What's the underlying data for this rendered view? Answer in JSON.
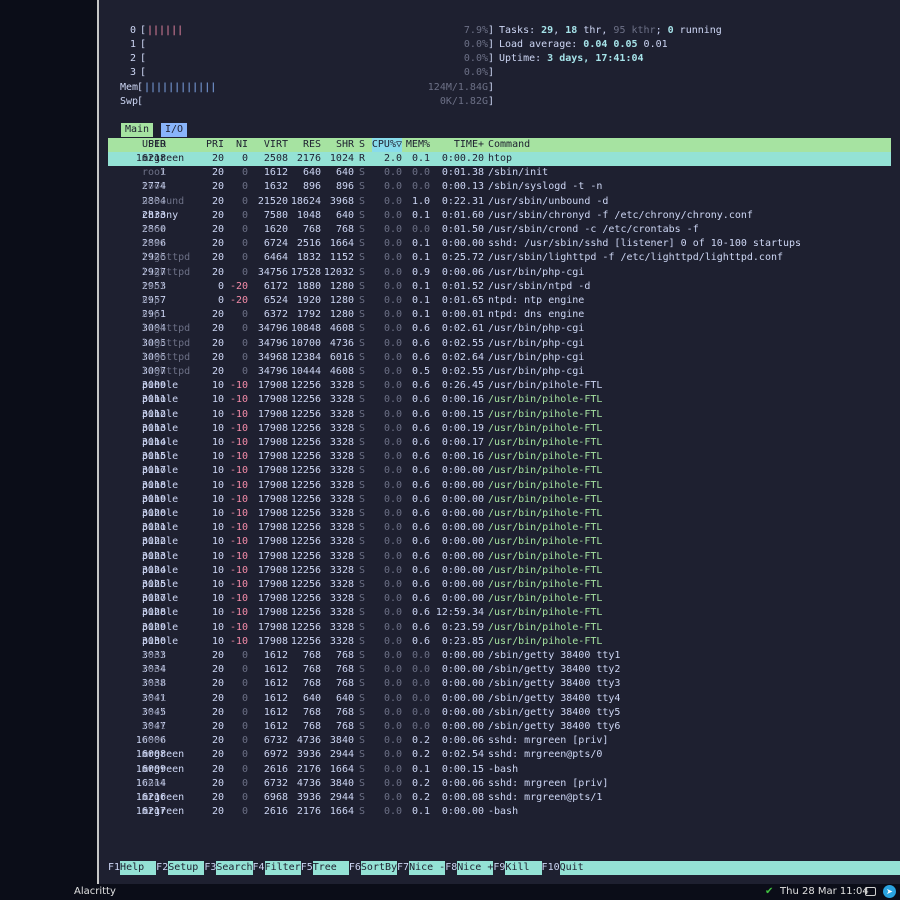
{
  "meters": [
    {
      "label": "0",
      "bars": "||||||",
      "value": "7.9%"
    },
    {
      "label": "1",
      "bars": "",
      "value": "0.0%"
    },
    {
      "label": "2",
      "bars": "",
      "value": "0.0%"
    },
    {
      "label": "3",
      "bars": "",
      "value": "0.0%"
    },
    {
      "label": "Mem",
      "bars": "||||||||||||",
      "value": "124M/1.84G"
    },
    {
      "label": "Swp",
      "bars": "",
      "value": "0K/1.82G"
    }
  ],
  "info": {
    "tasks_label": "Tasks: ",
    "tasks": "29",
    "thr_sep": ", ",
    "thr": "18",
    "thr_label": " thr, ",
    "kthr": "95 kthr",
    "kthr_sep": "; ",
    "running": "0",
    "running_label": " running",
    "load_label": "Load average: ",
    "load1": "0.04",
    "load5": "0.05",
    "load15": "0.01",
    "uptime_label": "Uptime: ",
    "uptime": "3 days, 17:41:04"
  },
  "tabs": {
    "main": "Main",
    "io": "I/O"
  },
  "header": {
    "pid": "PID",
    "user": "USER",
    "pri": "PRI",
    "ni": "NI",
    "virt": "VIRT",
    "res": "RES",
    "shr": "SHR",
    "s": "S",
    "cpu": "CPU%▽",
    "mem": "MEM%",
    "time": "TIME+",
    "cmd": "Command"
  },
  "processes": [
    [
      "16218",
      "mrgreen",
      "20",
      "0",
      "2508",
      "2176",
      "1024",
      "R",
      "2.0",
      "0.1",
      "0:00.20",
      "htop"
    ],
    [
      "1",
      "root",
      "20",
      "0",
      "1612",
      "640",
      "640",
      "S",
      "0.0",
      "0.0",
      "0:01.38",
      "/sbin/init"
    ],
    [
      "2774",
      "root",
      "20",
      "0",
      "1632",
      "896",
      "896",
      "S",
      "0.0",
      "0.0",
      "0:00.13",
      "/sbin/syslogd -t -n"
    ],
    [
      "2804",
      "unbound",
      "20",
      "0",
      "21520",
      "18624",
      "3968",
      "S",
      "0.0",
      "1.0",
      "0:22.31",
      "/usr/sbin/unbound -d"
    ],
    [
      "2833",
      "chrony",
      "20",
      "0",
      "7580",
      "1048",
      "640",
      "S",
      "0.0",
      "0.1",
      "0:01.60",
      "/usr/sbin/chronyd -f /etc/chrony/chrony.conf"
    ],
    [
      "2860",
      "root",
      "20",
      "0",
      "1620",
      "768",
      "768",
      "S",
      "0.0",
      "0.0",
      "0:01.50",
      "/usr/sbin/crond -c /etc/crontabs -f"
    ],
    [
      "2896",
      "root",
      "20",
      "0",
      "6724",
      "2516",
      "1664",
      "S",
      "0.0",
      "0.1",
      "0:00.00",
      "sshd: /usr/sbin/sshd [listener] 0 of 10-100 startups"
    ],
    [
      "2926",
      "lighttpd",
      "20",
      "0",
      "6464",
      "1832",
      "1152",
      "S",
      "0.0",
      "0.1",
      "0:25.72",
      "/usr/sbin/lighttpd -f /etc/lighttpd/lighttpd.conf"
    ],
    [
      "2927",
      "lighttpd",
      "20",
      "0",
      "34756",
      "17528",
      "12032",
      "S",
      "0.0",
      "0.9",
      "0:00.06",
      "/usr/bin/php-cgi"
    ],
    [
      "2953",
      "root",
      "0",
      "-20",
      "6172",
      "1880",
      "1280",
      "S",
      "0.0",
      "0.1",
      "0:01.52",
      "/usr/sbin/ntpd -d"
    ],
    [
      "2957",
      "ntp",
      "0",
      "-20",
      "6524",
      "1920",
      "1280",
      "S",
      "0.0",
      "0.1",
      "0:01.65",
      "ntpd: ntp engine"
    ],
    [
      "2961",
      "ntp",
      "20",
      "0",
      "6372",
      "1792",
      "1280",
      "S",
      "0.0",
      "0.1",
      "0:00.01",
      "ntpd: dns engine"
    ],
    [
      "3004",
      "lighttpd",
      "20",
      "0",
      "34796",
      "10848",
      "4608",
      "S",
      "0.0",
      "0.6",
      "0:02.61",
      "/usr/bin/php-cgi"
    ],
    [
      "3005",
      "lighttpd",
      "20",
      "0",
      "34796",
      "10700",
      "4736",
      "S",
      "0.0",
      "0.6",
      "0:02.55",
      "/usr/bin/php-cgi"
    ],
    [
      "3006",
      "lighttpd",
      "20",
      "0",
      "34968",
      "12384",
      "6016",
      "S",
      "0.0",
      "0.6",
      "0:02.64",
      "/usr/bin/php-cgi"
    ],
    [
      "3007",
      "lighttpd",
      "20",
      "0",
      "34796",
      "10444",
      "4608",
      "S",
      "0.0",
      "0.5",
      "0:02.55",
      "/usr/bin/php-cgi"
    ],
    [
      "3009",
      "pihole",
      "10",
      "-10",
      "17908",
      "12256",
      "3328",
      "S",
      "0.0",
      "0.6",
      "0:26.45",
      "/usr/bin/pihole-FTL"
    ],
    [
      "3011",
      "pihole",
      "10",
      "-10",
      "17908",
      "12256",
      "3328",
      "S",
      "0.0",
      "0.6",
      "0:00.16",
      "/usr/bin/pihole-FTL"
    ],
    [
      "3012",
      "pihole",
      "10",
      "-10",
      "17908",
      "12256",
      "3328",
      "S",
      "0.0",
      "0.6",
      "0:00.15",
      "/usr/bin/pihole-FTL"
    ],
    [
      "3013",
      "pihole",
      "10",
      "-10",
      "17908",
      "12256",
      "3328",
      "S",
      "0.0",
      "0.6",
      "0:00.19",
      "/usr/bin/pihole-FTL"
    ],
    [
      "3014",
      "pihole",
      "10",
      "-10",
      "17908",
      "12256",
      "3328",
      "S",
      "0.0",
      "0.6",
      "0:00.17",
      "/usr/bin/pihole-FTL"
    ],
    [
      "3015",
      "pihole",
      "10",
      "-10",
      "17908",
      "12256",
      "3328",
      "S",
      "0.0",
      "0.6",
      "0:00.16",
      "/usr/bin/pihole-FTL"
    ],
    [
      "3017",
      "pihole",
      "10",
      "-10",
      "17908",
      "12256",
      "3328",
      "S",
      "0.0",
      "0.6",
      "0:00.00",
      "/usr/bin/pihole-FTL"
    ],
    [
      "3018",
      "pihole",
      "10",
      "-10",
      "17908",
      "12256",
      "3328",
      "S",
      "0.0",
      "0.6",
      "0:00.00",
      "/usr/bin/pihole-FTL"
    ],
    [
      "3019",
      "pihole",
      "10",
      "-10",
      "17908",
      "12256",
      "3328",
      "S",
      "0.0",
      "0.6",
      "0:00.00",
      "/usr/bin/pihole-FTL"
    ],
    [
      "3020",
      "pihole",
      "10",
      "-10",
      "17908",
      "12256",
      "3328",
      "S",
      "0.0",
      "0.6",
      "0:00.00",
      "/usr/bin/pihole-FTL"
    ],
    [
      "3021",
      "pihole",
      "10",
      "-10",
      "17908",
      "12256",
      "3328",
      "S",
      "0.0",
      "0.6",
      "0:00.00",
      "/usr/bin/pihole-FTL"
    ],
    [
      "3022",
      "pihole",
      "10",
      "-10",
      "17908",
      "12256",
      "3328",
      "S",
      "0.0",
      "0.6",
      "0:00.00",
      "/usr/bin/pihole-FTL"
    ],
    [
      "3023",
      "pihole",
      "10",
      "-10",
      "17908",
      "12256",
      "3328",
      "S",
      "0.0",
      "0.6",
      "0:00.00",
      "/usr/bin/pihole-FTL"
    ],
    [
      "3024",
      "pihole",
      "10",
      "-10",
      "17908",
      "12256",
      "3328",
      "S",
      "0.0",
      "0.6",
      "0:00.00",
      "/usr/bin/pihole-FTL"
    ],
    [
      "3025",
      "pihole",
      "10",
      "-10",
      "17908",
      "12256",
      "3328",
      "S",
      "0.0",
      "0.6",
      "0:00.00",
      "/usr/bin/pihole-FTL"
    ],
    [
      "3027",
      "pihole",
      "10",
      "-10",
      "17908",
      "12256",
      "3328",
      "S",
      "0.0",
      "0.6",
      "0:00.00",
      "/usr/bin/pihole-FTL"
    ],
    [
      "3028",
      "pihole",
      "10",
      "-10",
      "17908",
      "12256",
      "3328",
      "S",
      "0.0",
      "0.6",
      "12:59.34",
      "/usr/bin/pihole-FTL"
    ],
    [
      "3029",
      "pihole",
      "10",
      "-10",
      "17908",
      "12256",
      "3328",
      "S",
      "0.0",
      "0.6",
      "0:23.59",
      "/usr/bin/pihole-FTL"
    ],
    [
      "3030",
      "pihole",
      "10",
      "-10",
      "17908",
      "12256",
      "3328",
      "S",
      "0.0",
      "0.6",
      "0:23.85",
      "/usr/bin/pihole-FTL"
    ],
    [
      "3033",
      "root",
      "20",
      "0",
      "1612",
      "768",
      "768",
      "S",
      "0.0",
      "0.0",
      "0:00.00",
      "/sbin/getty 38400 tty1"
    ],
    [
      "3034",
      "root",
      "20",
      "0",
      "1612",
      "768",
      "768",
      "S",
      "0.0",
      "0.0",
      "0:00.00",
      "/sbin/getty 38400 tty2"
    ],
    [
      "3038",
      "root",
      "20",
      "0",
      "1612",
      "768",
      "768",
      "S",
      "0.0",
      "0.0",
      "0:00.00",
      "/sbin/getty 38400 tty3"
    ],
    [
      "3041",
      "root",
      "20",
      "0",
      "1612",
      "640",
      "640",
      "S",
      "0.0",
      "0.0",
      "0:00.00",
      "/sbin/getty 38400 tty4"
    ],
    [
      "3045",
      "root",
      "20",
      "0",
      "1612",
      "768",
      "768",
      "S",
      "0.0",
      "0.0",
      "0:00.00",
      "/sbin/getty 38400 tty5"
    ],
    [
      "3047",
      "root",
      "20",
      "0",
      "1612",
      "768",
      "768",
      "S",
      "0.0",
      "0.0",
      "0:00.00",
      "/sbin/getty 38400 tty6"
    ],
    [
      "16006",
      "root",
      "20",
      "0",
      "6732",
      "4736",
      "3840",
      "S",
      "0.0",
      "0.2",
      "0:00.06",
      "sshd: mrgreen [priv]"
    ],
    [
      "16008",
      "mrgreen",
      "20",
      "0",
      "6972",
      "3936",
      "2944",
      "S",
      "0.0",
      "0.2",
      "0:02.54",
      "sshd: mrgreen@pts/0"
    ],
    [
      "16009",
      "mrgreen",
      "20",
      "0",
      "2616",
      "2176",
      "1664",
      "S",
      "0.0",
      "0.1",
      "0:00.15",
      "-bash"
    ],
    [
      "16214",
      "root",
      "20",
      "0",
      "6732",
      "4736",
      "3840",
      "S",
      "0.0",
      "0.2",
      "0:00.06",
      "sshd: mrgreen [priv]"
    ],
    [
      "16216",
      "mrgreen",
      "20",
      "0",
      "6968",
      "3936",
      "2944",
      "S",
      "0.0",
      "0.2",
      "0:00.08",
      "sshd: mrgreen@pts/1"
    ],
    [
      "16217",
      "mrgreen",
      "20",
      "0",
      "2616",
      "2176",
      "1664",
      "S",
      "0.0",
      "0.1",
      "0:00.00",
      "-bash"
    ]
  ],
  "fkeys": [
    {
      "key": "F1",
      "label": "Help  "
    },
    {
      "key": "F2",
      "label": "Setup "
    },
    {
      "key": "F3",
      "label": "Search"
    },
    {
      "key": "F4",
      "label": "Filter"
    },
    {
      "key": "F5",
      "label": "Tree  "
    },
    {
      "key": "F6",
      "label": "SortBy"
    },
    {
      "key": "F7",
      "label": "Nice -"
    },
    {
      "key": "F8",
      "label": "Nice +"
    },
    {
      "key": "F9",
      "label": "Kill  "
    },
    {
      "key": "F10",
      "label": "Quit"
    }
  ],
  "taskbar": {
    "app": "Alacritty",
    "clock": "Thu 28 Mar 11:04",
    "icons": [
      "check-icon",
      "camera-icon",
      "telegram-icon"
    ]
  },
  "colors": {
    "bg": "#1e2030",
    "header": "#a6e3a1",
    "selected": "#94e2d5",
    "io_tab": "#89b4fa",
    "negative_nice": "#f38ba8"
  }
}
